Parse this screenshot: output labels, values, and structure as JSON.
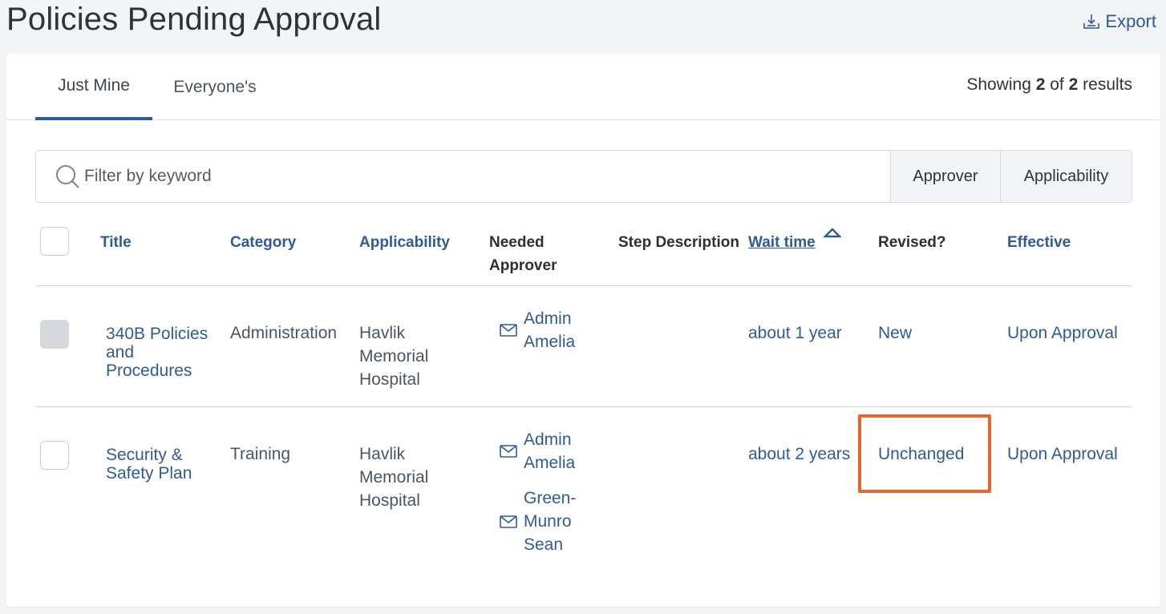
{
  "header": {
    "title": "Policies Pending Approval",
    "export_label": "Export"
  },
  "tabs": [
    {
      "label": "Just Mine",
      "active": true
    },
    {
      "label": "Everyone's",
      "active": false
    }
  ],
  "results": {
    "prefix": "Showing",
    "shown": "2",
    "of": "of",
    "total": "2",
    "suffix": "results"
  },
  "filter": {
    "placeholder": "Filter by keyword",
    "approver_label": "Approver",
    "applicability_label": "Applicability"
  },
  "columns": {
    "title": "Title",
    "category": "Category",
    "applicability": "Applicability",
    "needed_approver_1": "Needed",
    "needed_approver_2": "Approver",
    "step_description": "Step Description",
    "wait_time": "Wait time",
    "revised": "Revised?",
    "effective": "Effective"
  },
  "rows": [
    {
      "title_lines": [
        "340B Policies",
        "and",
        "Procedures"
      ],
      "category": "Administration",
      "applicability_lines": [
        "Havlik",
        "Memorial",
        "Hospital"
      ],
      "approvers": [
        {
          "lines": [
            "Admin",
            "Amelia"
          ]
        }
      ],
      "step_description": "",
      "wait_time": "about 1 year",
      "revised": "New",
      "effective": "Upon Approval",
      "checkbox_disabled": true
    },
    {
      "title_lines": [
        "Security &",
        "Safety Plan"
      ],
      "category": "Training",
      "applicability_lines": [
        "Havlik",
        "Memorial",
        "Hospital"
      ],
      "approvers": [
        {
          "lines": [
            "Admin",
            "Amelia"
          ]
        },
        {
          "lines": [
            "Green-",
            "Munro",
            "Sean"
          ]
        }
      ],
      "step_description": "",
      "wait_time": "about 2 years",
      "revised": "Unchanged",
      "effective": "Upon Approval",
      "checkbox_disabled": false
    }
  ],
  "colors": {
    "link": "#2f5a9a",
    "highlight": "#e2692e",
    "background": "#f3f4f6"
  }
}
